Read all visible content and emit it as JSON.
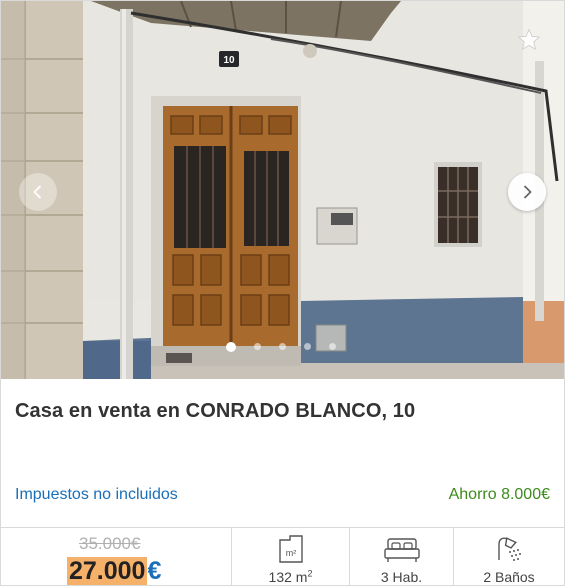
{
  "listing": {
    "title": "Casa en venta en CONRADO BLANCO, 10",
    "house_number_sign": "10",
    "taxes_note": "Impuestos no incluidos",
    "savings_note": "Ahorro 8.000€",
    "old_price": "35.000€",
    "price_amount": "27.000",
    "price_currency": "€",
    "area_value": "132 m",
    "area_unit_sup": "2",
    "area_icon_text": "m²",
    "rooms": "3 Hab.",
    "baths": "2 Baños"
  },
  "carousel": {
    "photo_count": 5,
    "active_index": 0
  },
  "icons": {
    "favorite": "star-icon",
    "prev": "chevron-left-icon",
    "next": "chevron-right-icon",
    "area": "floor-plan-icon",
    "rooms": "bed-icon",
    "baths": "shower-icon"
  },
  "colors": {
    "link_blue": "#1a6fb8",
    "savings_green": "#3d8a1e",
    "price_highlight": "#f5b06a"
  }
}
